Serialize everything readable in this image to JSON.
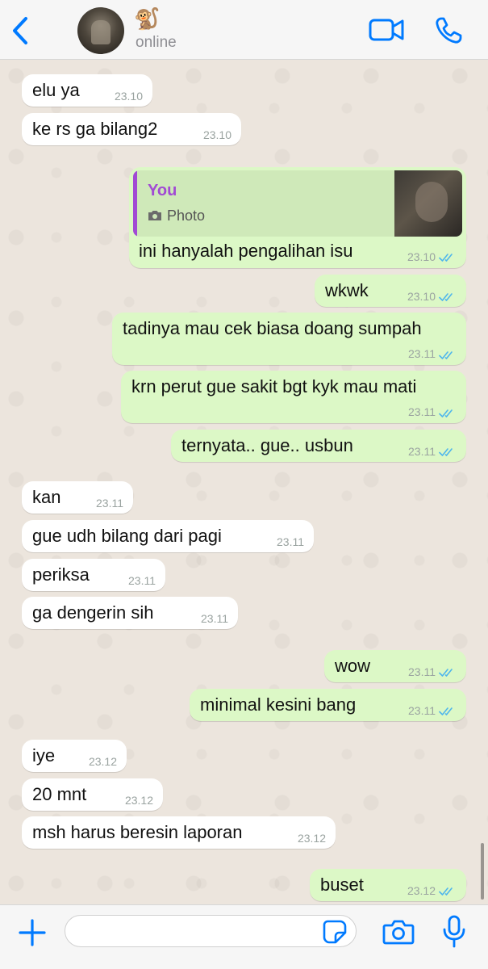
{
  "header": {
    "contact_name": "🐒",
    "status": "online"
  },
  "reply": {
    "author": "You",
    "type": "Photo"
  },
  "messages": [
    {
      "dir": "in",
      "text": "elu ya",
      "time": "23.10"
    },
    {
      "dir": "in",
      "text": "ke rs ga bilang2",
      "time": "23.10"
    },
    {
      "dir": "out",
      "text": "ini hanyalah pengalihan isu",
      "time": "23.10",
      "read": true
    },
    {
      "dir": "out",
      "text": "wkwk",
      "time": "23.10",
      "read": true
    },
    {
      "dir": "out",
      "text": "tadinya mau cek biasa doang sumpah",
      "time": "23.11",
      "read": true
    },
    {
      "dir": "out",
      "text": "krn perut gue sakit bgt kyk mau mati",
      "time": "23.11",
      "read": true
    },
    {
      "dir": "out",
      "text": "ternyata.. gue.. usbun",
      "time": "23.11",
      "read": true
    },
    {
      "dir": "in",
      "text": "kan",
      "time": "23.11"
    },
    {
      "dir": "in",
      "text": "gue udh bilang dari pagi",
      "time": "23.11"
    },
    {
      "dir": "in",
      "text": "periksa",
      "time": "23.11"
    },
    {
      "dir": "in",
      "text": "ga dengerin sih",
      "time": "23.11"
    },
    {
      "dir": "out",
      "text": "wow",
      "time": "23.11",
      "read": true
    },
    {
      "dir": "out",
      "text": "minimal kesini bang",
      "time": "23.11",
      "read": true
    },
    {
      "dir": "in",
      "text": "iye",
      "time": "23.12"
    },
    {
      "dir": "in",
      "text": "20 mnt",
      "time": "23.12"
    },
    {
      "dir": "in",
      "text": "msh harus beresin laporan",
      "time": "23.12"
    },
    {
      "dir": "out",
      "text": "buset",
      "time": "23.12",
      "read": true
    }
  ],
  "composer": {
    "placeholder": ""
  },
  "icons": {
    "back": "chevron-left-icon",
    "video": "video-camera-icon",
    "call": "phone-icon",
    "plus": "plus-icon",
    "sticker": "sticker-icon",
    "camera": "camera-icon",
    "mic": "microphone-icon",
    "read": "double-check-icon"
  },
  "colors": {
    "accent": "#007aff",
    "incoming_bubble": "#ffffff",
    "outgoing_bubble": "#dcf8c6",
    "read_ticks": "#4fb6ec",
    "reply_author": "#a14ad4",
    "chat_background": "#ece5dd"
  }
}
